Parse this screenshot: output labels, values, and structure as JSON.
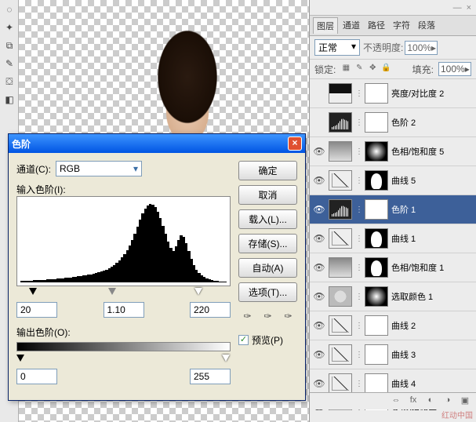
{
  "dialog": {
    "title": "色阶",
    "channel_label": "通道(C):",
    "channel_value": "RGB",
    "input_label": "输入色阶(I):",
    "output_label": "输出色阶(O):",
    "input_black": "20",
    "input_gamma": "1.10",
    "input_white": "220",
    "output_black": "0",
    "output_white": "255",
    "btn_ok": "确定",
    "btn_cancel": "取消",
    "btn_load": "载入(L)...",
    "btn_save": "存储(S)...",
    "btn_auto": "自动(A)",
    "btn_options": "选项(T)...",
    "preview_label": "预览(P)"
  },
  "panel": {
    "tabs": [
      "图层",
      "通道",
      "路径",
      "字符",
      "段落"
    ],
    "blend_mode": "正常",
    "opacity_label": "不透明度:",
    "opacity_value": "100%",
    "lock_label": "锁定:",
    "fill_label": "填充:",
    "fill_value": "100%",
    "layers": [
      {
        "name": "亮度/对比度 2",
        "thumb": "adj-bc",
        "mask": "mask-full",
        "vis": false
      },
      {
        "name": "色阶 2",
        "thumb": "adj-levels",
        "mask": "mask-full",
        "vis": false
      },
      {
        "name": "色相/饱和度 5",
        "thumb": "adj-hs",
        "mask": "mask-grad",
        "vis": true
      },
      {
        "name": "曲线 5",
        "thumb": "adj-curves",
        "mask": "mask-figure",
        "vis": true
      },
      {
        "name": "色阶 1",
        "thumb": "adj-levels",
        "mask": "mask-full",
        "vis": true,
        "selected": true
      },
      {
        "name": "曲线 1",
        "thumb": "adj-curves",
        "mask": "mask-figure",
        "vis": true
      },
      {
        "name": "色相/饱和度 1",
        "thumb": "adj-hs",
        "mask": "mask-figure",
        "vis": true
      },
      {
        "name": "选取颜色 1",
        "thumb": "adj-selcolor",
        "mask": "mask-grad",
        "vis": true
      },
      {
        "name": "曲线 2",
        "thumb": "adj-curves",
        "mask": "mask-full",
        "vis": true
      },
      {
        "name": "曲线 3",
        "thumb": "adj-curves",
        "mask": "mask-full",
        "vis": true
      },
      {
        "name": "曲线 4",
        "thumb": "adj-curves",
        "mask": "mask-full",
        "vis": true
      },
      {
        "name": "色相/饱和度",
        "thumb": "adj-hs",
        "mask": "mask-full",
        "vis": true
      }
    ]
  },
  "chart_data": {
    "type": "bar",
    "title": "输入色阶(I)",
    "xlabel": "",
    "ylabel": "",
    "xlim": [
      0,
      255
    ],
    "ylim": [
      0,
      100
    ],
    "values": [
      2,
      2,
      2,
      2,
      2,
      3,
      3,
      3,
      3,
      3,
      4,
      4,
      4,
      4,
      5,
      5,
      5,
      6,
      6,
      6,
      7,
      7,
      8,
      8,
      9,
      9,
      10,
      10,
      11,
      12,
      13,
      14,
      15,
      16,
      18,
      20,
      22,
      25,
      28,
      32,
      36,
      41,
      47,
      54,
      62,
      71,
      80,
      88,
      94,
      98,
      100,
      99,
      96,
      90,
      82,
      72,
      62,
      52,
      44,
      40,
      46,
      54,
      60,
      58,
      50,
      40,
      30,
      22,
      16,
      12,
      9,
      7,
      5,
      4,
      3,
      2,
      2,
      1,
      1,
      1
    ]
  },
  "watermark": "红动中国"
}
